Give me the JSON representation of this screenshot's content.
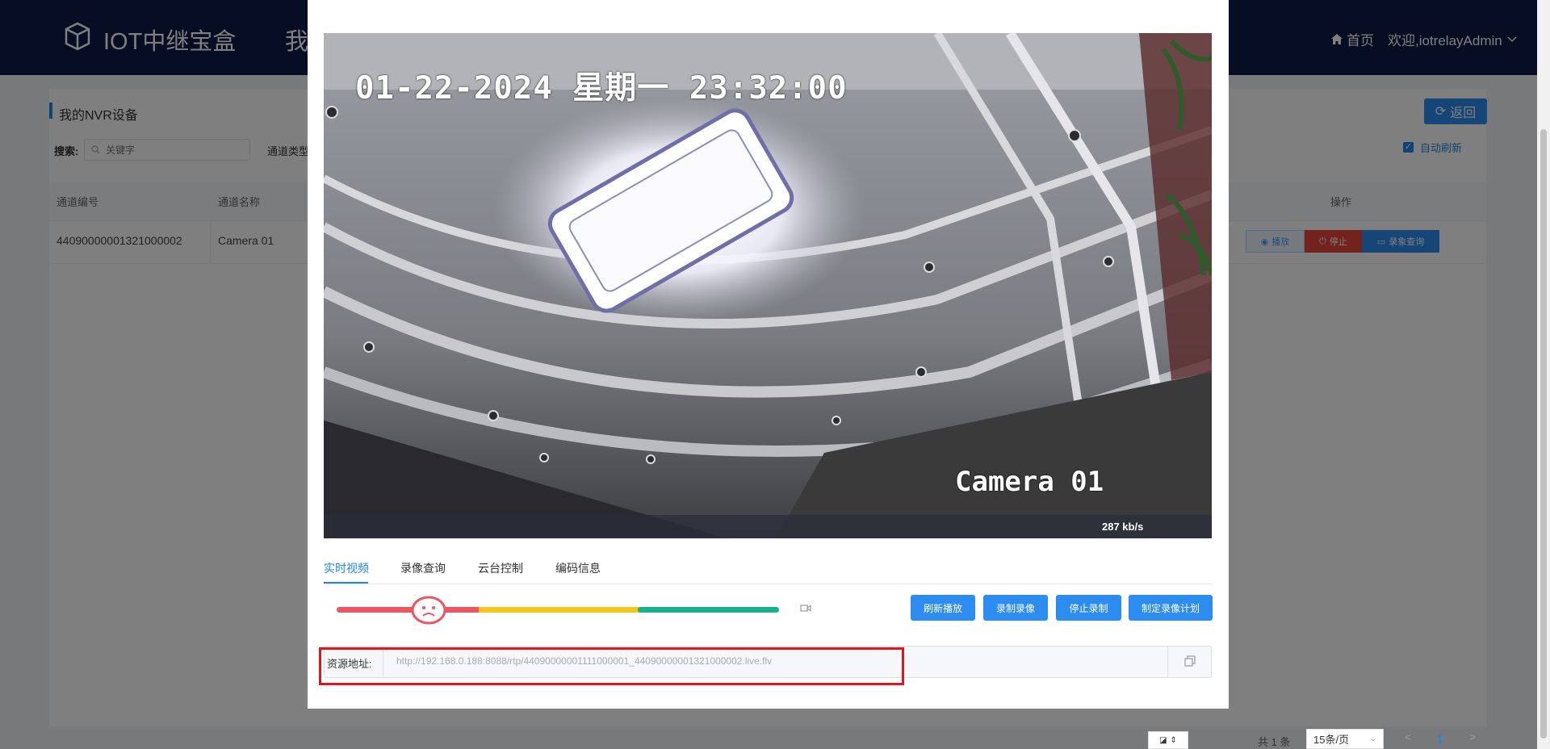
{
  "header": {
    "brand": "IOT中继宝盒",
    "nav_first": "我",
    "home": "首页",
    "welcome": "欢迎,iotrelayAdmin"
  },
  "page": {
    "title": "我的NVR设备",
    "back_button": "返回",
    "search_label": "搜索:",
    "search_placeholder": "关键字",
    "channel_type_label": "通道类型",
    "auto_refresh": "自动刷新"
  },
  "table": {
    "columns": [
      "通道编号",
      "通道名称",
      "操作"
    ],
    "rows": [
      {
        "channel_id": "44090000001321000002",
        "channel_name": "Camera 01"
      }
    ],
    "actions": {
      "play": "播放",
      "stop": "停止",
      "record_query": "录象查询"
    }
  },
  "pagination": {
    "total": "共 1 条",
    "page_size": "15条/页",
    "prev": "<",
    "current": "1",
    "next": ">"
  },
  "modal": {
    "video": {
      "osd_time": "01-22-2024 星期一 23:32:00",
      "osd_camera": "Camera 01",
      "bitrate": "287 kb/s"
    },
    "tabs": [
      {
        "label": "实时视频",
        "active": true
      },
      {
        "label": "录像查询",
        "active": false
      },
      {
        "label": "云台控制",
        "active": false
      },
      {
        "label": "编码信息",
        "active": false
      }
    ],
    "buttons": {
      "refresh_play": "刷新播放",
      "record": "录制录像",
      "stop_record": "停止录制",
      "schedule": "制定录像计划"
    },
    "resource": {
      "label": "资源地址:",
      "url": "http://192.168.0.188:8088/rtp/44090000001111000001_44090000001321000002.live.flv"
    },
    "signal_quality": "poor"
  },
  "colors": {
    "header_bg": "#0e1b45",
    "accent": "#2d8cf0",
    "danger": "#e8453c",
    "highlight_box": "#e0161b",
    "signal_red": "#ee5561",
    "signal_yellow": "#f8c51c",
    "signal_green": "#19b08c"
  }
}
